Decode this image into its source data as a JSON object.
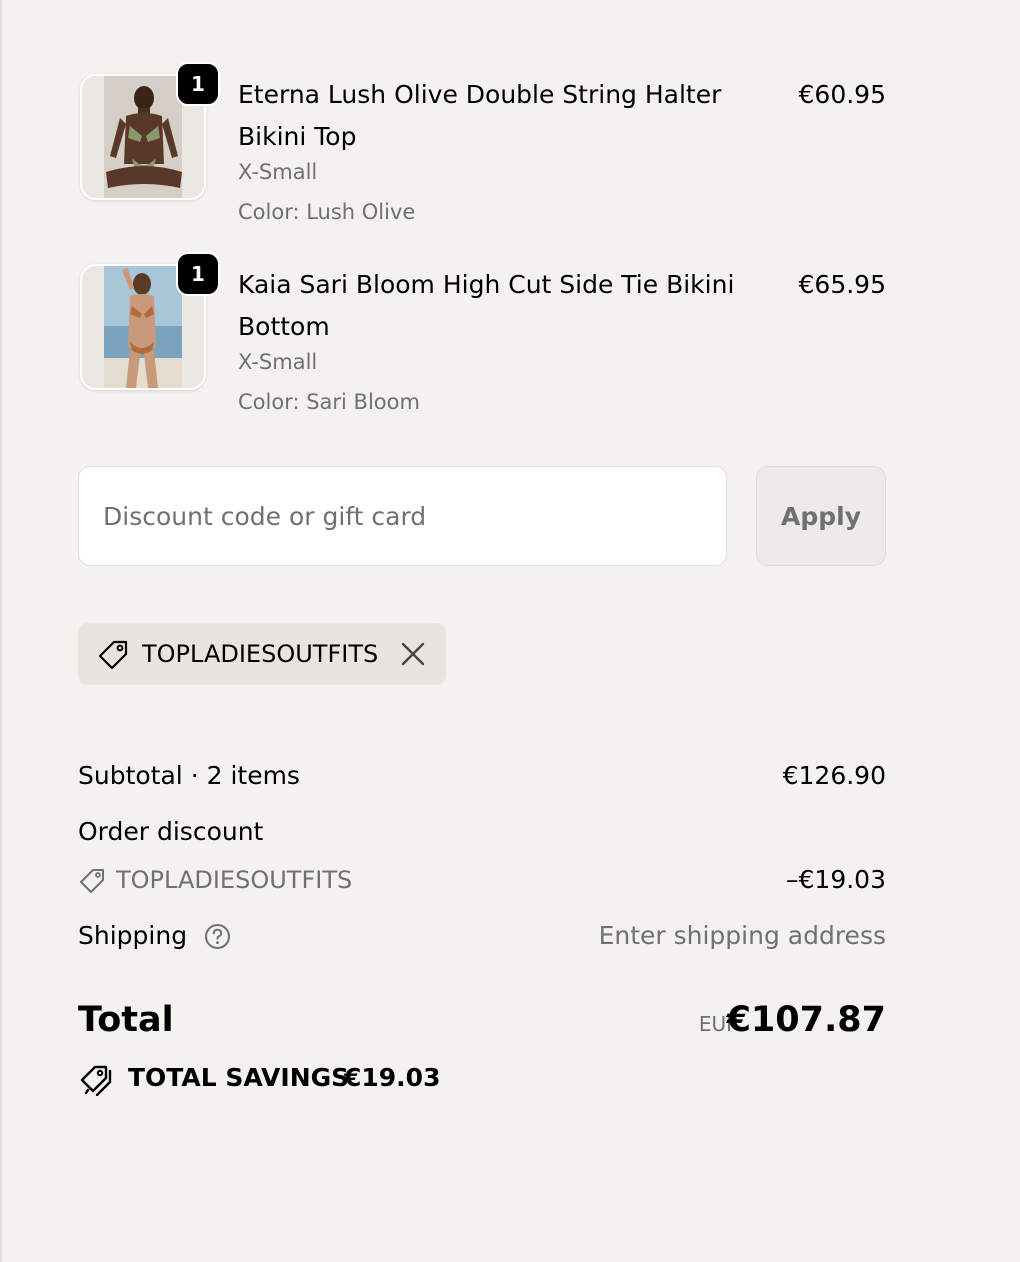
{
  "line_items": [
    {
      "quantity": "1",
      "title": "Eterna Lush Olive Double String Halter Bikini Top",
      "size": "X-Small",
      "color": "Color: Lush Olive",
      "price": "€60.95",
      "image_icon": "product-photo-olive-bikini-top"
    },
    {
      "quantity": "1",
      "title": "Kaia Sari Bloom High Cut Side Tie Bikini Bottom",
      "size": "X-Small",
      "color": "Color: Sari Bloom",
      "price": "€65.95",
      "image_icon": "product-photo-floral-bikini-bottom"
    }
  ],
  "discount": {
    "placeholder": "Discount code or gift card",
    "value": "",
    "apply_label": "Apply",
    "applied_code": "TOPLADIESOUTFITS"
  },
  "summary": {
    "subtotal_label": "Subtotal · 2 items",
    "subtotal_value": "€126.90",
    "order_discount_label": "Order discount",
    "discount_code": "TOPLADIESOUTFITS",
    "discount_value": "–€19.03",
    "shipping_label": "Shipping",
    "shipping_value": "Enter shipping address",
    "total_label": "Total",
    "currency": "EUR",
    "total_value": "€107.87",
    "savings_label": "TOTAL SAVINGS",
    "savings_value": "€19.03"
  },
  "colors": {
    "background": "#f3f2ef",
    "muted_text": "#707070",
    "chip_background": "#e8e5e1",
    "badge": "#000000"
  }
}
